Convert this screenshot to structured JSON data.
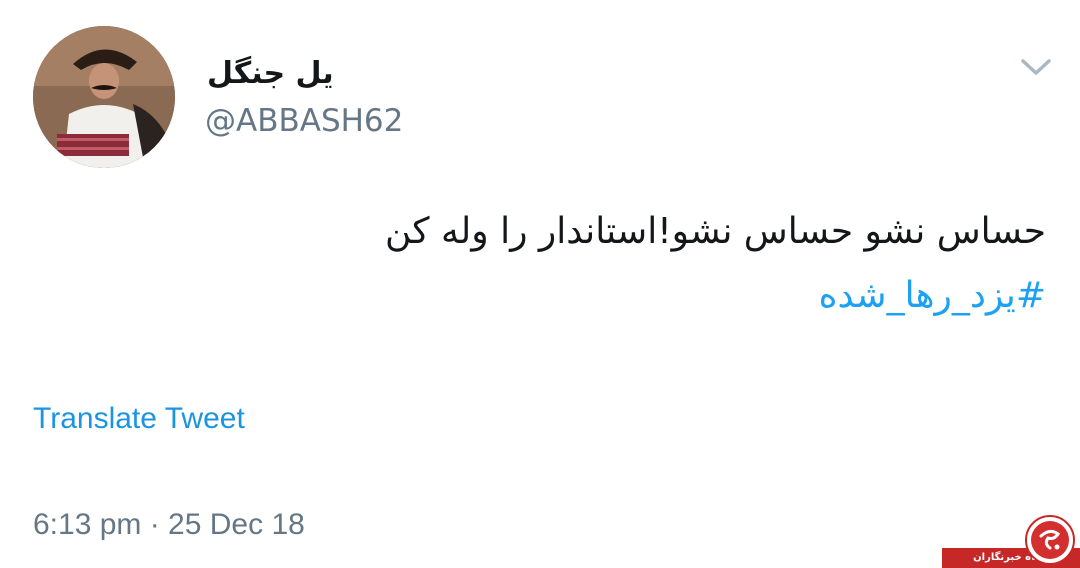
{
  "user": {
    "display_name": "یل جنگل",
    "handle": "@ABBASH62"
  },
  "tweet": {
    "text": "حساس نشو حساس نشو!استاندار را وله کن",
    "hashtag": "#یزد_رها_شده"
  },
  "actions": {
    "translate_label": "Translate Tweet"
  },
  "meta": {
    "timestamp": "6:13 pm · 25 Dec 18"
  },
  "icons": {
    "menu": "chevron-down-icon",
    "avatar": "avatar"
  },
  "watermark": {
    "text": "باشگاه خبرنگاران"
  },
  "colors": {
    "link": "#1da1f2",
    "secondary_text": "#657786",
    "primary_text": "#14171a",
    "watermark_red": "#c62828"
  }
}
